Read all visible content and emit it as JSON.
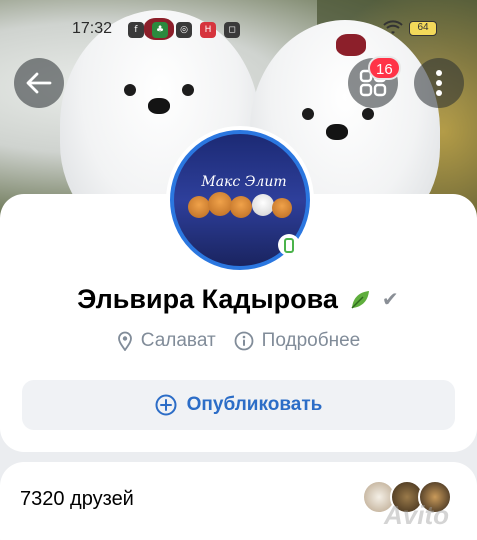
{
  "status_bar": {
    "time": "17:32",
    "battery": "64",
    "app_icons": [
      "facebook-icon",
      "game-icon",
      "vpn-icon",
      "news-icon",
      "instagram-icon"
    ]
  },
  "header": {
    "notifications_count": "16"
  },
  "avatar": {
    "banner_text": "Макс Элит"
  },
  "profile": {
    "name": "Эльвира Кадырова",
    "city": "Салават",
    "details_link": "Подробнее"
  },
  "actions": {
    "publish_label": "Опубликовать"
  },
  "friends": {
    "count_label": "7320 друзей"
  },
  "watermark": "Avito",
  "colors": {
    "accent": "#2c6dc7",
    "avatar_ring": "#2b77e0",
    "badge": "#ff3347",
    "online": "#4bb34b",
    "muted": "#818c99"
  }
}
